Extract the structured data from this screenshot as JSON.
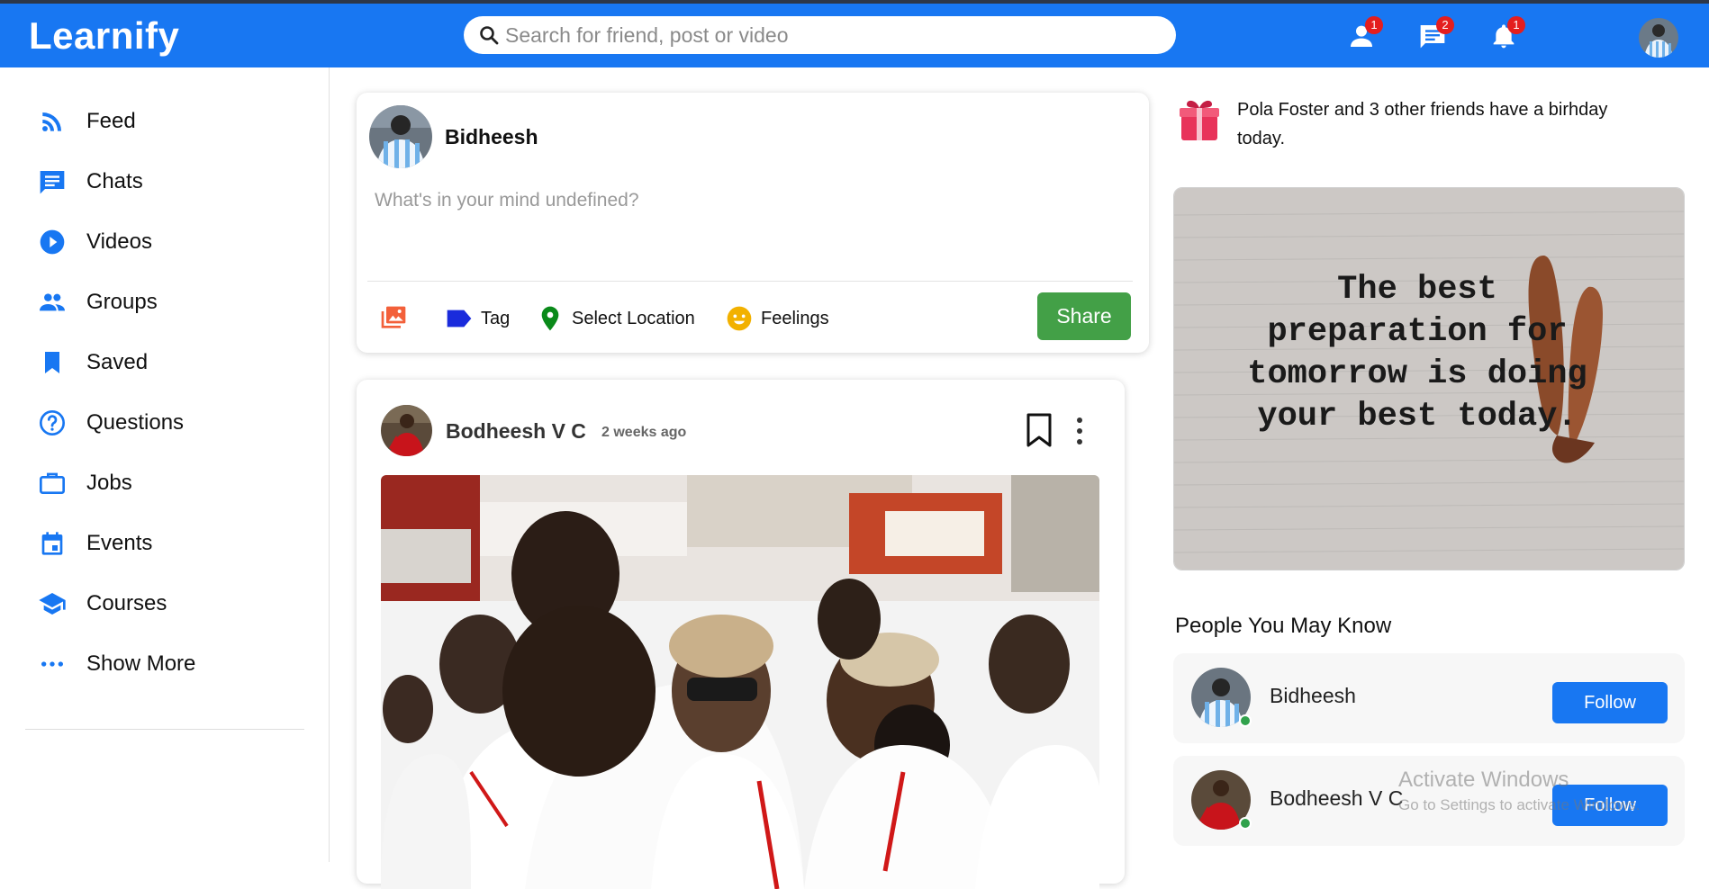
{
  "app": {
    "name": "Learnify"
  },
  "search": {
    "placeholder": "Search for friend, post or video"
  },
  "topbar": {
    "icons": [
      {
        "name": "person-icon",
        "badge": "1"
      },
      {
        "name": "chat-icon",
        "badge": "2"
      },
      {
        "name": "bell-icon",
        "badge": "1"
      }
    ]
  },
  "sidebar": {
    "items": [
      {
        "label": "Feed",
        "icon": "rss-icon"
      },
      {
        "label": "Chats",
        "icon": "chat-icon"
      },
      {
        "label": "Videos",
        "icon": "play-circle-icon"
      },
      {
        "label": "Groups",
        "icon": "group-icon"
      },
      {
        "label": "Saved",
        "icon": "bookmark-icon"
      },
      {
        "label": "Questions",
        "icon": "help-circle-icon"
      },
      {
        "label": "Jobs",
        "icon": "briefcase-icon"
      },
      {
        "label": "Events",
        "icon": "calendar-icon"
      },
      {
        "label": "Courses",
        "icon": "school-icon"
      },
      {
        "label": "Show More",
        "icon": "more-horizontal-icon"
      }
    ]
  },
  "share": {
    "username": "Bidheesh",
    "placeholder": "What's in your mind undefined?",
    "options": {
      "tag": "Tag",
      "location": "Select Location",
      "feelings": "Feelings"
    },
    "button": "Share"
  },
  "post": {
    "author": "Bodheesh V C",
    "time": "2 weeks ago"
  },
  "birthday": {
    "text": "Pola Foster and 3 other friends have a birhday today."
  },
  "quote": {
    "text": "The best preparation for tomorrow is doing your best today."
  },
  "people": {
    "title": "People You May Know",
    "list": [
      {
        "name": "Bidheesh",
        "button": "Follow"
      },
      {
        "name": "Bodheesh V C",
        "button": "Follow"
      }
    ]
  },
  "watermark": {
    "line1": "Activate Windows",
    "line2": "Go to Settings to activate Windows."
  },
  "colors": {
    "brand": "#1877f2",
    "share": "#43a047",
    "badge": "#e41e1e",
    "online": "#31a24c"
  }
}
